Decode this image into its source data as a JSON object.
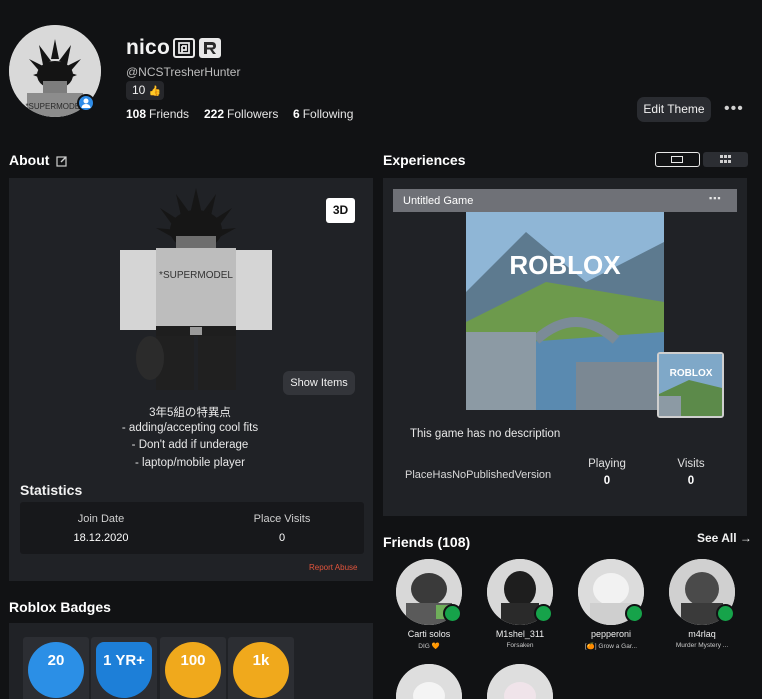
{
  "profile": {
    "display_name": "nico",
    "handle": "@NCSTresherHunter",
    "likes": "10",
    "friends_count": "108",
    "friends_label": "Friends",
    "followers_count": "222",
    "followers_label": "Followers",
    "following_count": "6",
    "following_label": "Following",
    "edit_theme_label": "Edit Theme",
    "more_label": "•••"
  },
  "about": {
    "heading": "About",
    "button_3d": "3D",
    "show_items": "Show Items",
    "bio": [
      "3年5組の特異点",
      "- adding/accepting cool fits",
      "- Don't add if underage",
      "- laptop/mobile player"
    ],
    "shirt_text": "*SUPERMODEL"
  },
  "statistics": {
    "heading": "Statistics",
    "join_date_label": "Join Date",
    "join_date_value": "18.12.2020",
    "place_visits_label": "Place Visits",
    "place_visits_value": "0",
    "report_label": "Report Abuse"
  },
  "badges": {
    "heading": "Roblox Badges",
    "items": [
      {
        "label": "20",
        "color": "#2b8fe6"
      },
      {
        "label": "1 YR+",
        "color": "#1d7fd8"
      },
      {
        "label": "100",
        "color": "#f0a91c"
      },
      {
        "label": "1k",
        "color": "#f0a91c"
      }
    ]
  },
  "experiences": {
    "heading": "Experiences",
    "game_title": "Untitled Game",
    "game_menu": "▪▪▪",
    "logo_text": "ROBLOX",
    "description": "This game has no description",
    "place_status": "PlaceHasNoPublishedVersion",
    "playing_label": "Playing",
    "playing_value": "0",
    "visits_label": "Visits",
    "visits_value": "0"
  },
  "friends": {
    "heading": "Friends (108)",
    "see_all": "See All →",
    "items": [
      {
        "name": "Carti solos",
        "sub": "DIG 🧡"
      },
      {
        "name": "M1shel_311",
        "sub": "Forsaken"
      },
      {
        "name": "pepperoni",
        "sub": "[🍊] Grow a Gar..."
      },
      {
        "name": "m4rlaq",
        "sub": "Murder Mystery ..."
      }
    ]
  },
  "colors": {
    "background": "#111214",
    "panel": "#202226",
    "accent_blue": "#2e8ce8",
    "online_green": "#16a34a",
    "report_red": "#e0543c"
  }
}
